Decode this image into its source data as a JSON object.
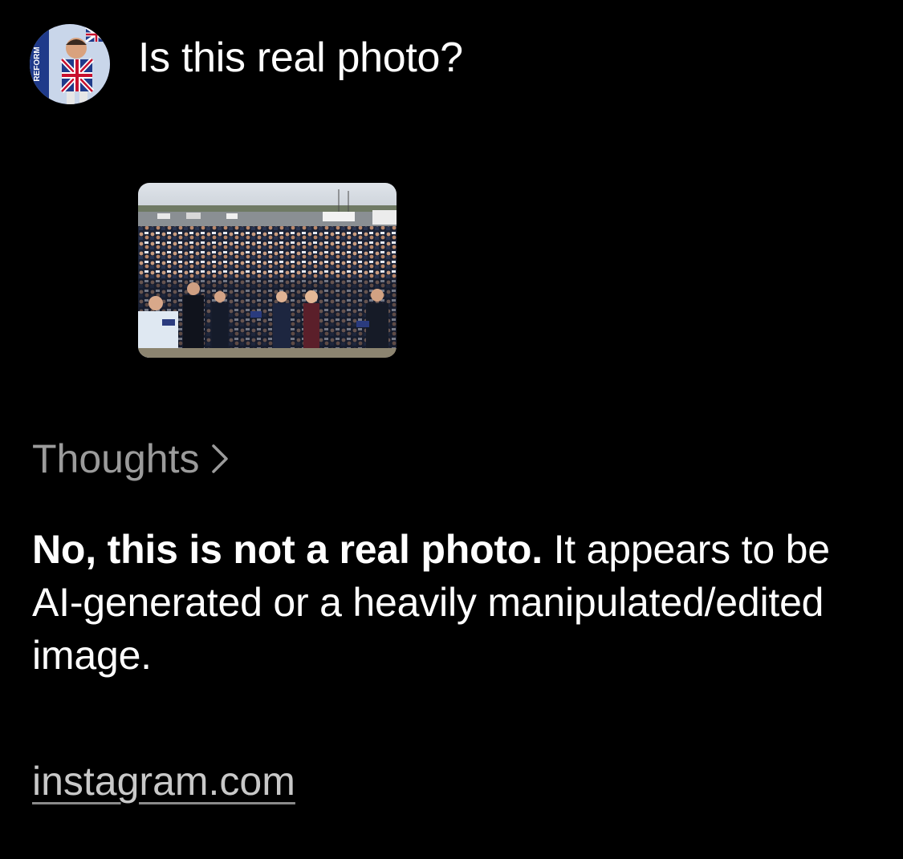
{
  "user_message": {
    "text": "Is this real photo?",
    "avatar": {
      "icon": "profile-avatar-icon",
      "text": "REFORM"
    },
    "attachment": {
      "icon": "photo-thumbnail-crowd"
    }
  },
  "response": {
    "thoughts_label": "Thoughts",
    "thoughts_icon": "chevron-right-icon",
    "answer_lead": "No, this is not a real photo.",
    "answer_rest": " It appears to be AI-generated or a heavily manipulated/edited image.",
    "source_link": "instagram.com"
  },
  "colors": {
    "background": "#000000",
    "text_primary": "#ffffff",
    "text_secondary": "#9b9b9b",
    "link": "#c8c8c8"
  }
}
